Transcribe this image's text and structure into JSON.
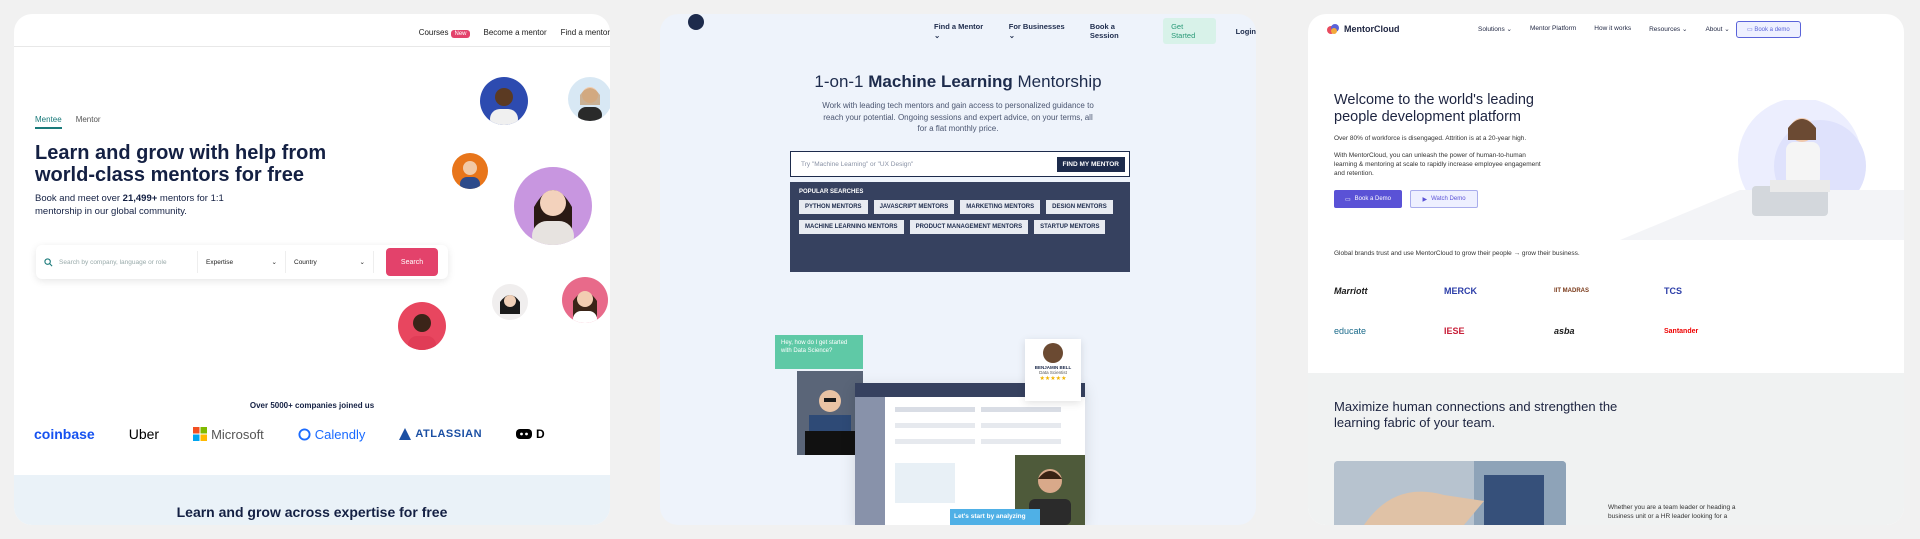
{
  "panel1": {
    "nav": {
      "courses": "Courses",
      "new_badge": "New",
      "become_mentor": "Become a mentor",
      "find_mentor": "Find a mentor"
    },
    "tabs": {
      "mentee": "Mentee",
      "mentor": "Mentor"
    },
    "headline": "Learn and grow with help from world-class mentors for free",
    "subtext_prefix": "Book and meet over ",
    "subtext_count": "21,499+",
    "subtext_suffix": " mentors for 1:1 mentorship in our global community.",
    "search": {
      "placeholder": "Search by company, language or role",
      "expertise": "Expertise",
      "country": "Country",
      "button": "Search"
    },
    "companies_title": "Over 5000+ companies joined us",
    "logos": {
      "coinbase": "coinbase",
      "uber": "Uber",
      "microsoft": "Microsoft",
      "calendly": "Calendly",
      "atlassian": "ATLASSIAN",
      "discord": "D"
    },
    "bottom_title": "Learn and grow across expertise for free"
  },
  "panel2": {
    "nav": {
      "find_mentor": "Find a Mentor",
      "for_businesses": "For Businesses",
      "book_session": "Book a Session",
      "get_started": "Get Started",
      "login": "Login"
    },
    "hero": {
      "prefix": "1-on-1 ",
      "highlight": "Machine Learning",
      "suffix": " Mentorship"
    },
    "hero_sub": "Work with leading tech mentors and gain access to personalized guidance to reach your potential. Ongoing sessions and expert advice, on your terms, all for a flat monthly price.",
    "search": {
      "placeholder": "Try \"Machine Learning\" or \"UX Design\"",
      "button": "FIND MY MENTOR"
    },
    "popular_title": "POPULAR SEARCHES",
    "chips": [
      "PYTHON MENTORS",
      "JAVASCRIPT MENTORS",
      "MARKETING MENTORS",
      "DESIGN MENTORS",
      "MACHINE LEARNING MENTORS",
      "PRODUCT MANAGEMENT MENTORS",
      "STARTUP MENTORS"
    ],
    "illus": {
      "bubble": "Hey, how do I get started with Data Science?",
      "mentor_name": "BENJAMIN BELL",
      "mentor_role": "Data Scientist",
      "stars": "★★★★★",
      "cta": "Let's start by analyzing"
    }
  },
  "panel3": {
    "brand": "MentorCloud",
    "nav": {
      "solutions": "Solutions",
      "platform": "Mentor Platform",
      "how": "How it works",
      "resources": "Resources",
      "about": "About",
      "demo": "Book a demo"
    },
    "headline": "Welcome to the world's leading people development platform",
    "stat": "Over 80% of workforce is disengaged. Attrition is at a 20-year high.",
    "body": "With MentorCloud, you can unleash the power of human-to-human learning & mentoring at scale to rapidly increase employee engagement and retention.",
    "book_demo": "Book a Demo",
    "watch_demo": "Watch Demo",
    "trust": "Global brands trust and use MentorCloud to grow their people → grow their business.",
    "logos": {
      "marriott": "Marriott",
      "merck": "MERCK",
      "iitm": "IIT MADRAS",
      "tcs": "TCS",
      "educate": "educate",
      "iese": "IESE",
      "asba": "asba",
      "santander": "Santander"
    },
    "section_title": "Maximize human connections and strengthen the learning fabric of your team.",
    "section_text": "Whether you are a team leader or heading a business unit or a HR leader looking for a"
  }
}
